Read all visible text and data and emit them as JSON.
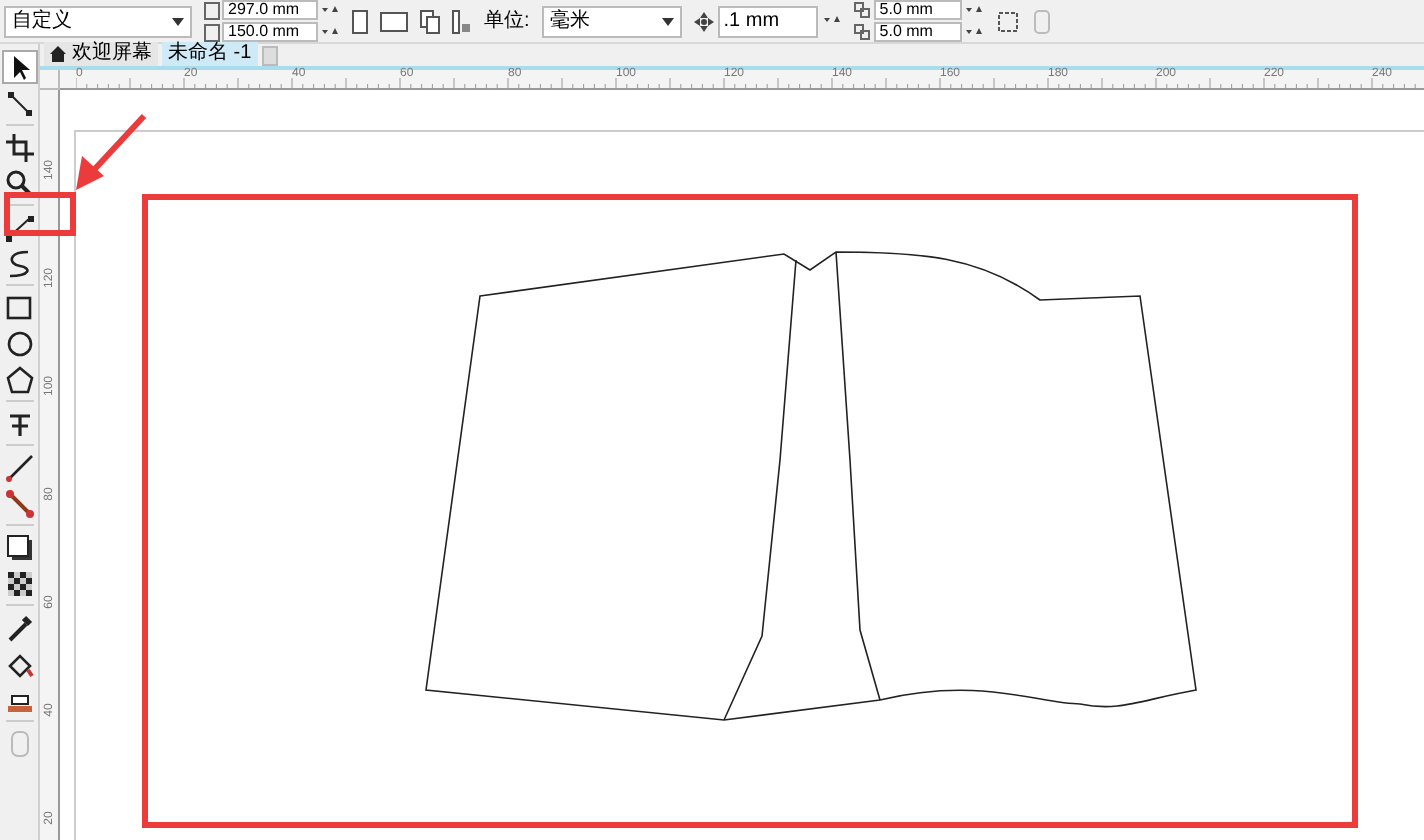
{
  "property_bar": {
    "page_preset": "自定义",
    "width": "297.0 mm",
    "height": "150.0 mm",
    "unit_label": "单位:",
    "unit": "毫米",
    "nudge": ".1 mm",
    "dup_x": "5.0 mm",
    "dup_y": "5.0 mm"
  },
  "tabs": [
    {
      "label": "欢迎屏幕",
      "kind": "home",
      "selected": false
    },
    {
      "label": "未命名 -1",
      "kind": "doc",
      "selected": true
    }
  ],
  "toolbox": [
    {
      "kind": "pointer",
      "selected": true
    },
    {
      "kind": "shape",
      "selected": false
    },
    {
      "kind": "crop",
      "selected": false
    },
    {
      "kind": "zoom",
      "selected": false
    },
    {
      "kind": "curve",
      "selected": false
    },
    {
      "kind": "smart",
      "selected": false
    },
    {
      "kind": "rect",
      "selected": false
    },
    {
      "kind": "ellipse",
      "selected": false
    },
    {
      "kind": "polygon",
      "selected": false
    },
    {
      "kind": "text",
      "selected": false
    },
    {
      "kind": "line",
      "selected": false
    },
    {
      "kind": "connector",
      "selected": false
    },
    {
      "kind": "shadow",
      "selected": false
    },
    {
      "kind": "transparency",
      "selected": false
    },
    {
      "kind": "eyedropper",
      "selected": false
    },
    {
      "kind": "fill",
      "selected": false
    },
    {
      "kind": "smartfill",
      "selected": false
    },
    {
      "kind": "more",
      "selected": false
    }
  ],
  "ruler": {
    "top_labels": [
      "0",
      "20",
      "40",
      "60",
      "80",
      "100",
      "120",
      "140",
      "160",
      "180",
      "200",
      "220",
      "240"
    ],
    "left_labels": [
      "140",
      "120",
      "100",
      "80",
      "60",
      "40",
      "20"
    ]
  }
}
